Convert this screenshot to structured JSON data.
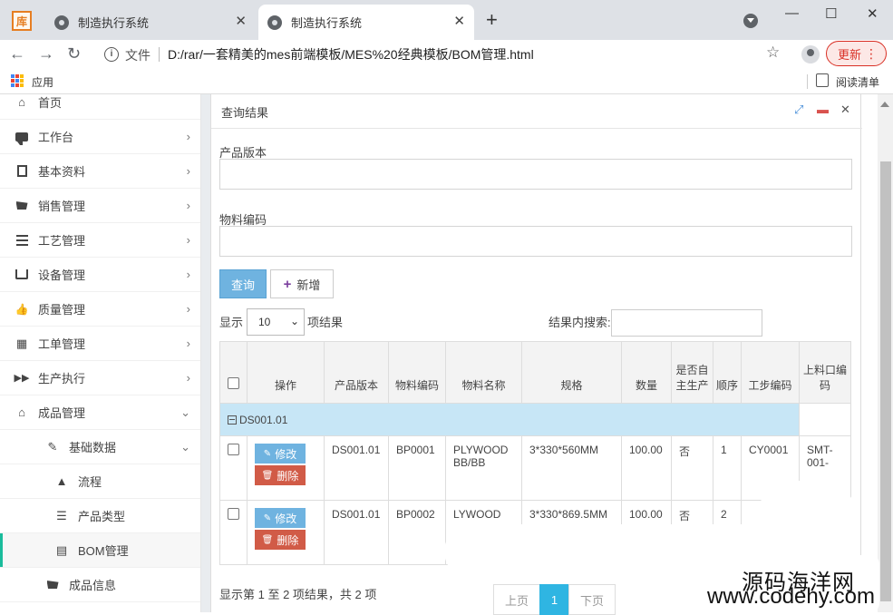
{
  "browser": {
    "logo_text": "库",
    "tabs": [
      {
        "title": "制造执行系统",
        "active": false
      },
      {
        "title": "制造执行系统",
        "active": true
      }
    ],
    "new_tab_symbol": "+",
    "win_min": "—",
    "win_max": "☐",
    "win_close": "✕",
    "file_label": "文件",
    "url": "D:/rar/一套精美的mes前端模板/MES%20经典模板/BOM管理.html",
    "update_label": "更新",
    "bookmarks_apps": "应用",
    "reading_list": "阅读清单"
  },
  "sidebar": {
    "items": [
      {
        "label": "首页",
        "icon": "home-icon",
        "glyph": "⌂",
        "has_chevron": false
      },
      {
        "label": "工作台",
        "icon": "comment-icon",
        "has_chevron": true
      },
      {
        "label": "基本资料",
        "icon": "document-icon",
        "has_chevron": true
      },
      {
        "label": "销售管理",
        "icon": "cart-icon",
        "has_chevron": true
      },
      {
        "label": "工艺管理",
        "icon": "list-icon",
        "has_chevron": true
      },
      {
        "label": "设备管理",
        "icon": "inbox-icon",
        "has_chevron": true
      },
      {
        "label": "质量管理",
        "icon": "thumbs-up-icon",
        "glyph": "👍",
        "has_chevron": true
      },
      {
        "label": "工单管理",
        "icon": "calendar-icon",
        "glyph": "▦",
        "has_chevron": true
      },
      {
        "label": "生产执行",
        "icon": "forward-icon",
        "glyph": "⏩",
        "has_chevron": true
      },
      {
        "label": "成品管理",
        "icon": "home-icon",
        "glyph": "⌂",
        "has_chevron": true,
        "expanded": true
      }
    ],
    "sub_items": [
      {
        "label": "基础数据",
        "icon": "wrench-icon",
        "glyph": "🔧",
        "expanded": true
      },
      {
        "label": "流程",
        "icon": "road-icon",
        "glyph": "▲"
      },
      {
        "label": "产品类型",
        "icon": "server-icon",
        "glyph": "☰"
      },
      {
        "label": "BOM管理",
        "icon": "document-icon",
        "glyph": "▤",
        "active": true
      },
      {
        "label": "成品信息",
        "icon": "cart-icon",
        "glyph": "🛒"
      }
    ],
    "chevron_right": "›",
    "chevron_down": "⌄"
  },
  "panel": {
    "title": "查询结果",
    "fields": [
      {
        "label": "产品版本",
        "value": "",
        "placeholder": ""
      },
      {
        "label": "物料编码",
        "value": "",
        "placeholder": ""
      }
    ],
    "query_button": "查询",
    "add_button": "新增",
    "length_prefix": "显示",
    "length_value": "10",
    "length_suffix": "项结果",
    "search_label": "结果内搜索:",
    "table": {
      "columns": [
        {
          "key": "check",
          "label": "",
          "width": 30
        },
        {
          "key": "op",
          "label": "操作",
          "width": 85
        },
        {
          "key": "version",
          "label": "产品版本",
          "width": 71
        },
        {
          "key": "code",
          "label": "物料编码",
          "width": 63
        },
        {
          "key": "name",
          "label": "物料名称",
          "width": 84
        },
        {
          "key": "spec",
          "label": "规格",
          "width": 110
        },
        {
          "key": "qty",
          "label": "数量",
          "width": 55
        },
        {
          "key": "self",
          "label": "是否自主生产",
          "width": 46
        },
        {
          "key": "seq",
          "label": "顺序",
          "width": 31
        },
        {
          "key": "step",
          "label": "工步编码",
          "width": 64
        },
        {
          "key": "port",
          "label": "上料口编码",
          "width": 57
        }
      ],
      "group_label": "DS001.01",
      "rows": [
        {
          "version": "DS001.01",
          "code": "BP0001",
          "name": "PLYWOOD BB/BB",
          "spec": "3*330*560MM",
          "qty": "100.00",
          "self": "否",
          "seq": "1",
          "step": "CY0001",
          "port": "SMT-001-"
        },
        {
          "version": "DS001.01",
          "code": "BP0002",
          "name": "LYWOOD",
          "spec": "3*330*869.5MM",
          "qty": "100.00",
          "self": "否",
          "seq": "2",
          "step": "",
          "port": ""
        }
      ],
      "edit_label": "修改",
      "delete_label": "删除"
    },
    "info": "显示第 1 至 2 项结果，共 2 项",
    "pager": {
      "prev": "上页",
      "current": "1",
      "next": "下页"
    }
  },
  "watermark": {
    "line1": "源码海洋网",
    "line2": "www.codehy.com"
  }
}
